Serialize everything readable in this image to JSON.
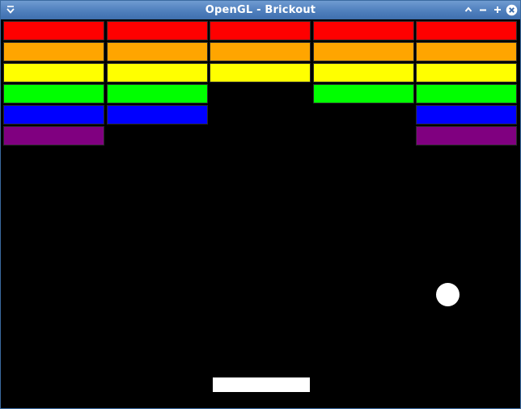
{
  "window": {
    "title": "OpenGL - Brickout"
  },
  "titlebar_icons": [
    "window-menu-icon",
    "shade-up-icon",
    "minimize-icon",
    "maximize-icon",
    "close-icon"
  ],
  "game": {
    "background": "#000000",
    "rows": [
      {
        "color": "#ff0000",
        "bricks": [
          true,
          true,
          true,
          true,
          true
        ]
      },
      {
        "color": "#ffa500",
        "bricks": [
          true,
          true,
          true,
          true,
          true
        ]
      },
      {
        "color": "#ffff00",
        "bricks": [
          true,
          true,
          true,
          true,
          true
        ]
      },
      {
        "color": "#00ff00",
        "bricks": [
          true,
          true,
          false,
          true,
          true
        ]
      },
      {
        "color": "#0000ff",
        "bricks": [
          true,
          true,
          false,
          false,
          true
        ]
      },
      {
        "color": "#800080",
        "bricks": [
          true,
          false,
          false,
          false,
          true
        ]
      }
    ],
    "ball_color": "#ffffff",
    "paddle_color": "#ffffff"
  }
}
